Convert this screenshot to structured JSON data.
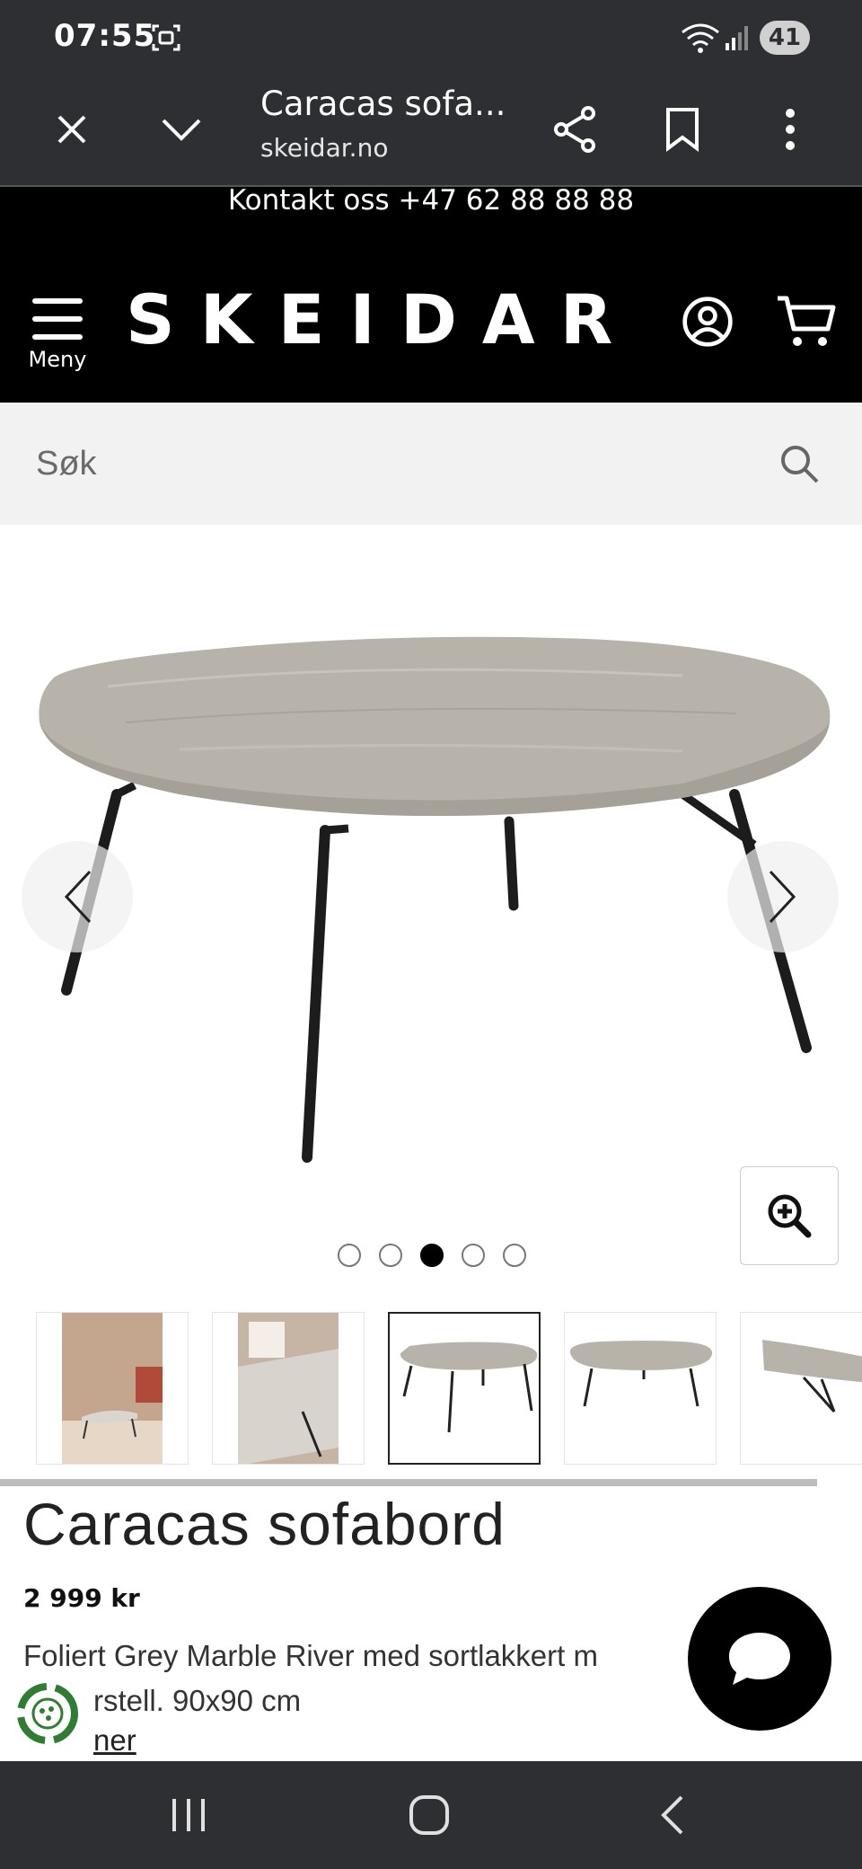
{
  "status_bar": {
    "time": "07:55",
    "battery": "41"
  },
  "browser": {
    "page_title": "Caracas sofa...",
    "url": "skeidar.no"
  },
  "site": {
    "contact_text": "Kontakt oss +47 62 88 88 88",
    "menu_label": "Meny",
    "logo": "SKEIDAR",
    "search_placeholder": "Søk"
  },
  "gallery": {
    "dot_count": 5,
    "active_dot": 3,
    "thumbnails": [
      {
        "name": "thumb-1"
      },
      {
        "name": "thumb-2"
      },
      {
        "name": "thumb-3",
        "selected": true
      },
      {
        "name": "thumb-4"
      },
      {
        "name": "thumb-5"
      }
    ]
  },
  "product": {
    "title": "Caracas sofabord",
    "price": "2 999 kr",
    "description": "Foliert Grey Marble River med sortlakkert m",
    "description_line2": "rstell. 90x90 cm",
    "link": "ner"
  },
  "colors": {
    "chrome": "#2e2f33",
    "brand_bg": "#000000",
    "search_bg": "#f2f2f2",
    "tabletop": "#b8b3aa",
    "eco_green": "#2e7d32"
  }
}
